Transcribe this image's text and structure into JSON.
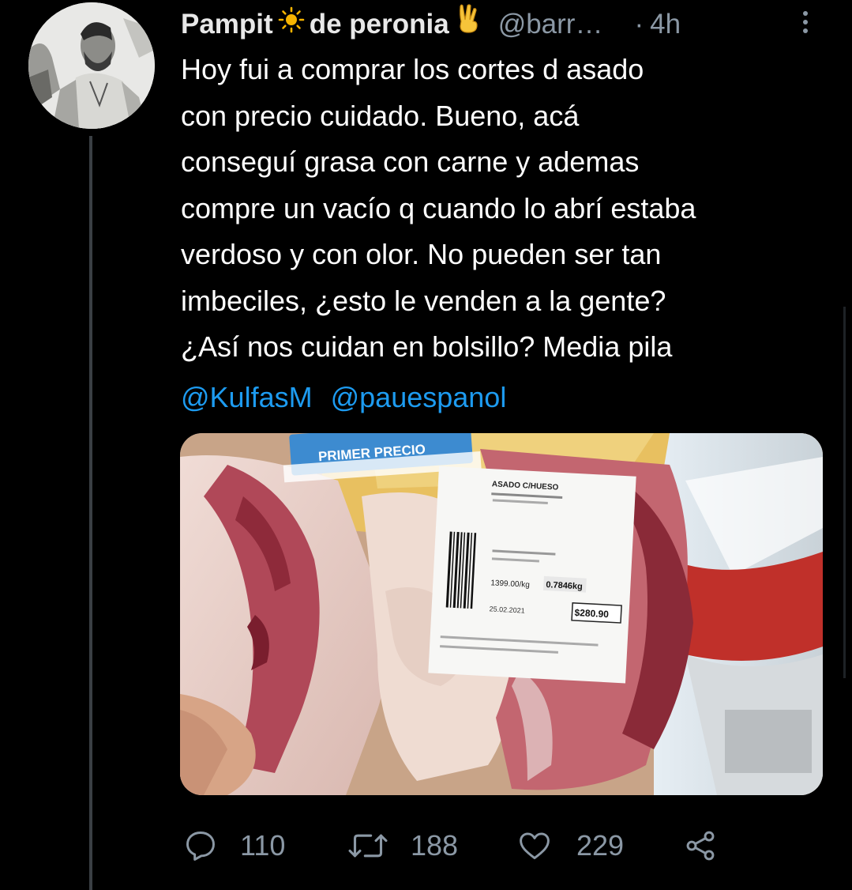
{
  "tweet": {
    "display_name": "Pampit",
    "display_name_suffix": "de peronia",
    "handle": "@barr…",
    "separator": "·",
    "timestamp": "4h",
    "text_lines": [
      "Hoy fui a comprar los cortes d asado",
      "con precio cuidado. Bueno, acá",
      "conseguí grasa con carne y ademas",
      "compre un vacío q cuando lo abrí estaba",
      "verdoso y con olor. No pueden ser tan",
      "imbeciles, ¿esto le venden a la gente?",
      "¿Así nos cuidan en bolsillo? Media pila"
    ],
    "mentions": [
      "@KulfasM",
      "@pauespanol"
    ]
  },
  "photo": {
    "sticker_text": "PRIMER PRECIO",
    "label_title": "ASADO C/HUESO",
    "price_per_kg": "1399.00/kg",
    "weight": "0.7846kg",
    "date": "25.02.2021",
    "total_price": "$280.90"
  },
  "actions": {
    "reply_count": "110",
    "retweet_count": "188",
    "like_count": "229"
  },
  "icons": {
    "sun_emoji": "sun-icon",
    "victory_emoji": "victory-hand-icon",
    "reply": "reply-icon",
    "retweet": "retweet-icon",
    "like": "heart-icon",
    "share": "share-icon",
    "more": "more-vertical-icon"
  },
  "colors": {
    "background": "#000000",
    "text": "#ffffff",
    "secondary": "#8b98a5",
    "link": "#1d9bf0"
  }
}
